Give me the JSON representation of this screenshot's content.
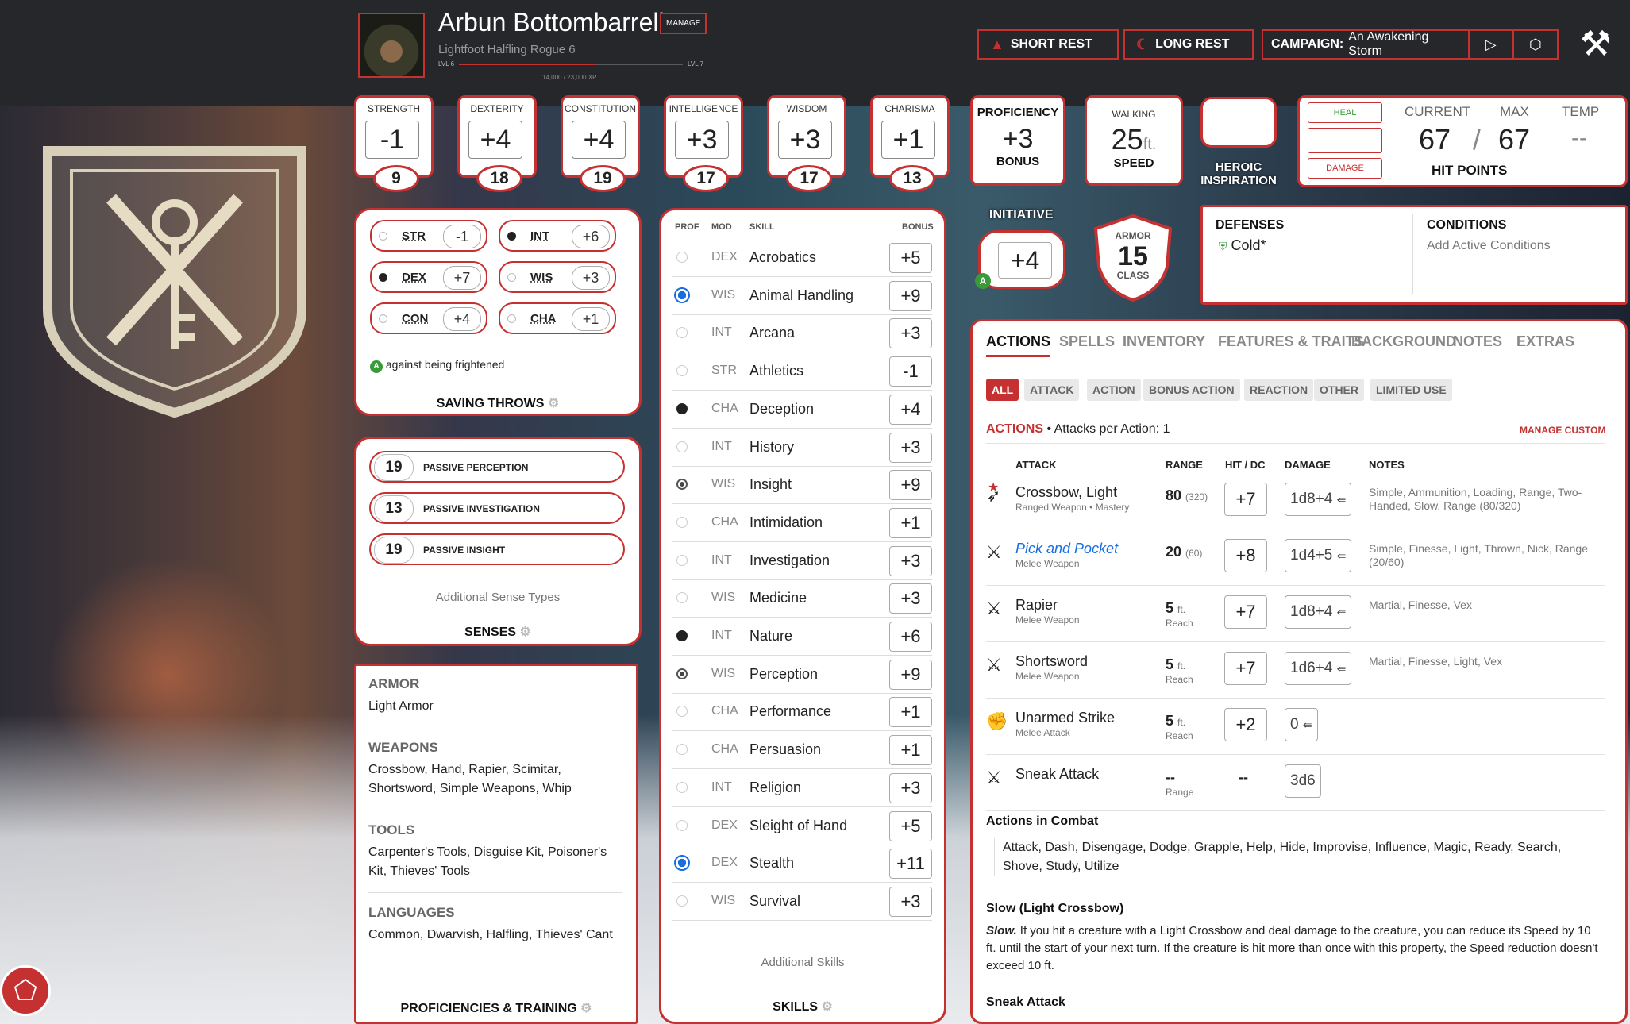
{
  "character": {
    "name": "Arbun Bottombarrell",
    "manage_label": "MANAGE",
    "subtitle": "Lightfoot Halfling  Rogue 6",
    "lvl_current": "LVL 6",
    "lvl_next": "LVL 7",
    "xp": "14,000 / 23,000 XP",
    "xp_progress": 0.61
  },
  "topbar": {
    "short_rest": "SHORT REST",
    "long_rest": "LONG REST",
    "campaign_label": "CAMPAIGN:",
    "campaign_name": "An Awakening Storm"
  },
  "abilities": [
    {
      "name": "STRENGTH",
      "mod": "-1",
      "score": "9"
    },
    {
      "name": "DEXTERITY",
      "mod": "+4",
      "score": "18"
    },
    {
      "name": "CONSTITUTION",
      "mod": "+4",
      "score": "19"
    },
    {
      "name": "INTELLIGENCE",
      "mod": "+3",
      "score": "17"
    },
    {
      "name": "WISDOM",
      "mod": "+3",
      "score": "17"
    },
    {
      "name": "CHARISMA",
      "mod": "+1",
      "score": "13"
    }
  ],
  "proficiency": {
    "title": "PROFICIENCY",
    "value": "+3",
    "label": "BONUS"
  },
  "speed": {
    "title": "WALKING",
    "value": "25",
    "unit": "ft.",
    "label": "SPEED"
  },
  "heroic": {
    "label1": "HEROIC",
    "label2": "INSPIRATION"
  },
  "hp": {
    "heal": "HEAL",
    "damage": "DAMAGE",
    "current_label": "CURRENT",
    "max_label": "MAX",
    "temp_label": "TEMP",
    "current": "67",
    "sep": "/",
    "max": "67",
    "temp": "--",
    "title": "HIT POINTS"
  },
  "initiative": {
    "label": "INITIATIVE",
    "value": "+4"
  },
  "armor": {
    "label1": "ARMOR",
    "value": "15",
    "label2": "CLASS"
  },
  "defenses": {
    "title": "DEFENSES",
    "value": "Cold*"
  },
  "conditions": {
    "title": "CONDITIONS",
    "value": "Add Active Conditions"
  },
  "saving_throws": {
    "items": [
      {
        "ab": "STR",
        "val": "-1",
        "prof": false
      },
      {
        "ab": "INT",
        "val": "+6",
        "prof": true
      },
      {
        "ab": "DEX",
        "val": "+7",
        "prof": true
      },
      {
        "ab": "WIS",
        "val": "+3",
        "prof": false
      },
      {
        "ab": "CON",
        "val": "+4",
        "prof": false
      },
      {
        "ab": "CHA",
        "val": "+1",
        "prof": false
      }
    ],
    "note": "against being frightened",
    "title": "SAVING THROWS"
  },
  "senses": {
    "items": [
      {
        "val": "19",
        "label": "PASSIVE PERCEPTION"
      },
      {
        "val": "13",
        "label": "PASSIVE INVESTIGATION"
      },
      {
        "val": "19",
        "label": "PASSIVE INSIGHT"
      }
    ],
    "additional": "Additional Sense Types",
    "title": "SENSES"
  },
  "proficiencies": {
    "armor_h": "ARMOR",
    "armor_v": "Light Armor",
    "weapons_h": "WEAPONS",
    "weapons_v": "Crossbow, Hand, Rapier, Scimitar, Shortsword, Simple Weapons, Whip",
    "tools_h": "TOOLS",
    "tools_v": "Carpenter's Tools, Disguise Kit, Poisoner's Kit, Thieves' Tools",
    "languages_h": "LANGUAGES",
    "languages_v": "Common, Dwarvish, Halfling, Thieves' Cant",
    "title": "PROFICIENCIES & TRAINING"
  },
  "skills": {
    "headers": {
      "prof": "PROF",
      "mod": "MOD",
      "skill": "SKILL",
      "bonus": "BONUS"
    },
    "items": [
      {
        "mod": "DEX",
        "name": "Acrobatics",
        "bonus": "+5",
        "prof": "none"
      },
      {
        "mod": "WIS",
        "name": "Animal Handling",
        "bonus": "+9",
        "prof": "expertise"
      },
      {
        "mod": "INT",
        "name": "Arcana",
        "bonus": "+3",
        "prof": "none"
      },
      {
        "mod": "STR",
        "name": "Athletics",
        "bonus": "-1",
        "prof": "none"
      },
      {
        "mod": "CHA",
        "name": "Deception",
        "bonus": "+4",
        "prof": "proficient"
      },
      {
        "mod": "INT",
        "name": "History",
        "bonus": "+3",
        "prof": "none"
      },
      {
        "mod": "WIS",
        "name": "Insight",
        "bonus": "+9",
        "prof": "half"
      },
      {
        "mod": "CHA",
        "name": "Intimidation",
        "bonus": "+1",
        "prof": "none"
      },
      {
        "mod": "INT",
        "name": "Investigation",
        "bonus": "+3",
        "prof": "none"
      },
      {
        "mod": "WIS",
        "name": "Medicine",
        "bonus": "+3",
        "prof": "none"
      },
      {
        "mod": "INT",
        "name": "Nature",
        "bonus": "+6",
        "prof": "proficient"
      },
      {
        "mod": "WIS",
        "name": "Perception",
        "bonus": "+9",
        "prof": "half"
      },
      {
        "mod": "CHA",
        "name": "Performance",
        "bonus": "+1",
        "prof": "none"
      },
      {
        "mod": "CHA",
        "name": "Persuasion",
        "bonus": "+1",
        "prof": "none"
      },
      {
        "mod": "INT",
        "name": "Religion",
        "bonus": "+3",
        "prof": "none"
      },
      {
        "mod": "DEX",
        "name": "Sleight of Hand",
        "bonus": "+5",
        "prof": "none"
      },
      {
        "mod": "DEX",
        "name": "Stealth",
        "bonus": "+11",
        "prof": "expertise"
      },
      {
        "mod": "WIS",
        "name": "Survival",
        "bonus": "+3",
        "prof": "none"
      }
    ],
    "additional": "Additional Skills",
    "title": "SKILLS"
  },
  "tabs": [
    "ACTIONS",
    "SPELLS",
    "INVENTORY",
    "FEATURES & TRAITS",
    "BACKGROUND",
    "NOTES",
    "EXTRAS"
  ],
  "filters": [
    "ALL",
    "ATTACK",
    "ACTION",
    "BONUS ACTION",
    "REACTION",
    "OTHER",
    "LIMITED USE"
  ],
  "actions": {
    "heading": "ACTIONS",
    "per_action": "• Attacks per Action: 1",
    "manage_custom": "MANAGE CUSTOM",
    "headers": {
      "attack": "ATTACK",
      "range": "RANGE",
      "hit": "HIT / DC",
      "damage": "DAMAGE",
      "notes": "NOTES"
    },
    "attacks": [
      {
        "name": "Crossbow, Light",
        "sub": "Ranged Weapon • Mastery",
        "range": "80",
        "range_long": "(320)",
        "range_sub": "",
        "hit": "+7",
        "damage": "1d8+4",
        "notes": "Simple, Ammunition, Loading, Range, Two-Handed, Slow, Range (80/320)"
      },
      {
        "name": "Pick and Pocket",
        "sub": "Melee Weapon",
        "range": "20",
        "range_long": "(60)",
        "range_sub": "",
        "hit": "+8",
        "damage": "1d4+5",
        "notes": "Simple, Finesse, Light, Thrown, Nick, Range (20/60)"
      },
      {
        "name": "Rapier",
        "sub": "Melee Weapon",
        "range": "5",
        "range_long": "ft.",
        "range_sub": "Reach",
        "hit": "+7",
        "damage": "1d8+4",
        "notes": "Martial, Finesse, Vex"
      },
      {
        "name": "Shortsword",
        "sub": "Melee Weapon",
        "range": "5",
        "range_long": "ft.",
        "range_sub": "Reach",
        "hit": "+7",
        "damage": "1d6+4",
        "notes": "Martial, Finesse, Light, Vex"
      },
      {
        "name": "Unarmed Strike",
        "sub": "Melee Attack",
        "range": "5",
        "range_long": "ft.",
        "range_sub": "Reach",
        "hit": "+2",
        "damage": "0",
        "notes": ""
      },
      {
        "name": "Sneak Attack",
        "sub": "",
        "range": "--",
        "range_long": "",
        "range_sub": "Range",
        "hit": "--",
        "damage": "3d6",
        "notes": ""
      }
    ],
    "combat_title": "Actions in Combat",
    "combat_list": "Attack, Dash, Disengage, Dodge, Grapple, Help, Hide, Improvise, Influence, Magic, Ready, Search, Shove, Study, Utilize",
    "slow_title": "Slow (Light Crossbow)",
    "slow_lead": "Slow.",
    "slow_text": " If you hit a creature with a Light Crossbow and deal damage to the creature, you can reduce its Speed by 10 ft. until the start of your next turn. If the creature is hit more than once with this property, the Speed reduction doesn't exceed 10 ft.",
    "sneak_title": "Sneak Attack"
  },
  "colors": {
    "accent": "#c53131",
    "link": "#1a6fe0"
  }
}
